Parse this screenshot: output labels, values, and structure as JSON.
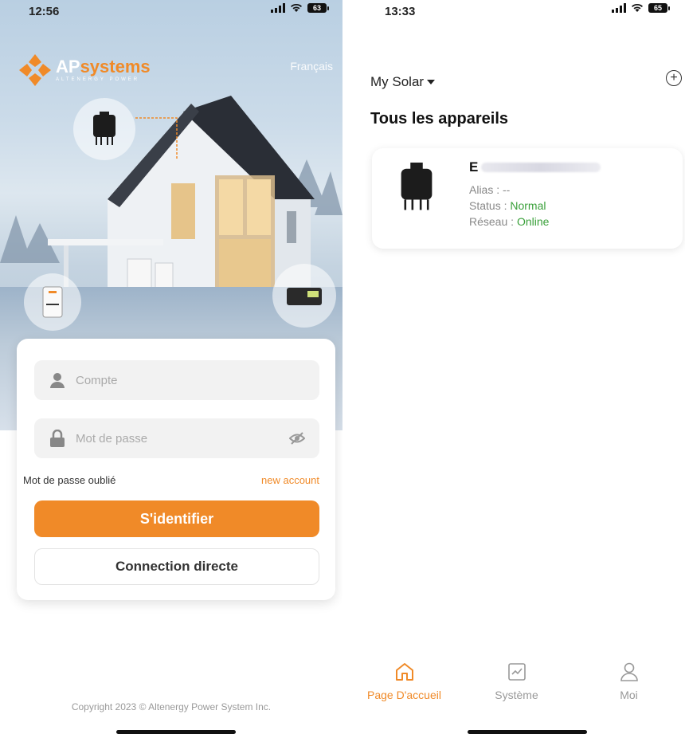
{
  "left": {
    "status_time": "12:56",
    "battery": "63",
    "language": "Français",
    "logo": {
      "main_ap": "AP",
      "main_systems": "systems",
      "sub": "ALTENERGY POWER"
    },
    "login": {
      "account_placeholder": "Compte",
      "password_placeholder": "Mot de passe",
      "forgot_password": "Mot de passe oublié",
      "new_account": "new account",
      "login_button": "S'identifier",
      "direct_button": "Connection directe"
    },
    "copyright": "Copyright 2023 © Altenergy Power System Inc."
  },
  "right": {
    "status_time": "13:33",
    "battery": "65",
    "site_selector": "My Solar",
    "section_title": "Tous les appareils",
    "device": {
      "serial_prefix": "E",
      "alias": "Alias : --",
      "status_label": "Status : ",
      "status_value": "Normal",
      "network_label": "Réseau : ",
      "network_value": "Online"
    },
    "tabs": [
      {
        "label": "Page D'accueil",
        "icon": "home-icon",
        "active": true
      },
      {
        "label": "Système",
        "icon": "chart-icon",
        "active": false
      },
      {
        "label": "Moi",
        "icon": "user-icon",
        "active": false
      }
    ]
  },
  "colors": {
    "accent": "#f08a28",
    "ok_green": "#3aa03a"
  }
}
